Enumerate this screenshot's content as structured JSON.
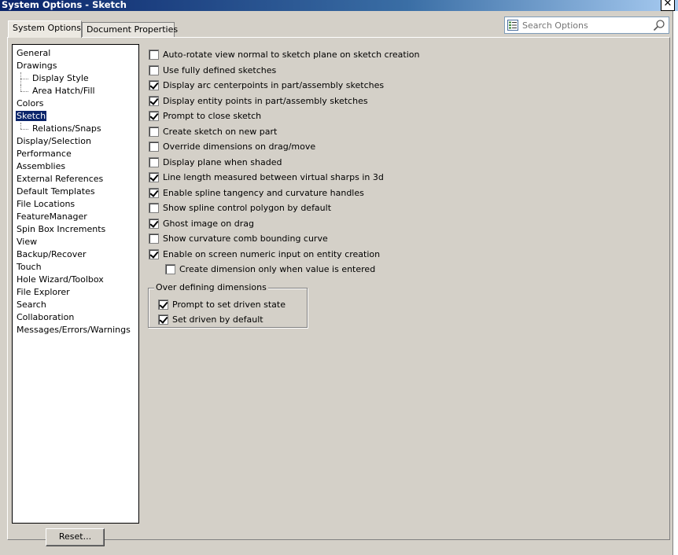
{
  "window": {
    "title": "System Options - Sketch",
    "close_label": "✕"
  },
  "tabs": [
    {
      "label": "System Options",
      "active": true
    },
    {
      "label": "Document Properties",
      "active": false
    }
  ],
  "search": {
    "placeholder": "Search Options",
    "value": ""
  },
  "tree": {
    "items": [
      {
        "label": "General"
      },
      {
        "label": "Drawings"
      },
      {
        "label": "Display Style"
      },
      {
        "label": "Area Hatch/Fill"
      },
      {
        "label": "Colors"
      },
      {
        "label": "Sketch"
      },
      {
        "label": "Relations/Snaps"
      },
      {
        "label": "Display/Selection"
      },
      {
        "label": "Performance"
      },
      {
        "label": "Assemblies"
      },
      {
        "label": "External References"
      },
      {
        "label": "Default Templates"
      },
      {
        "label": "File Locations"
      },
      {
        "label": "FeatureManager"
      },
      {
        "label": "Spin Box Increments"
      },
      {
        "label": "View"
      },
      {
        "label": "Backup/Recover"
      },
      {
        "label": "Touch"
      },
      {
        "label": "Hole Wizard/Toolbox"
      },
      {
        "label": "File Explorer"
      },
      {
        "label": "Search"
      },
      {
        "label": "Collaboration"
      },
      {
        "label": "Messages/Errors/Warnings"
      }
    ]
  },
  "options": [
    {
      "label": "Auto-rotate view normal to sketch plane on sketch creation",
      "checked": false
    },
    {
      "label": "Use fully defined sketches",
      "checked": false
    },
    {
      "label": "Display arc centerpoints in part/assembly sketches",
      "checked": true
    },
    {
      "label": "Display entity points in part/assembly sketches",
      "checked": true
    },
    {
      "label": "Prompt to close sketch",
      "checked": true
    },
    {
      "label": "Create sketch on new part",
      "checked": false
    },
    {
      "label": "Override dimensions on drag/move",
      "checked": false
    },
    {
      "label": "Display plane when shaded",
      "checked": false
    },
    {
      "label": "Line length measured between virtual sharps in 3d",
      "checked": true
    },
    {
      "label": "Enable spline tangency and curvature handles",
      "checked": true
    },
    {
      "label": "Show spline control polygon by default",
      "checked": false
    },
    {
      "label": "Ghost image on drag",
      "checked": true
    },
    {
      "label": "Show curvature comb bounding curve",
      "checked": false
    },
    {
      "label": "Enable on screen numeric input on entity creation",
      "checked": true
    },
    {
      "label": "Create dimension only when value is entered",
      "checked": false
    }
  ],
  "over_defining": {
    "legend": "Over defining dimensions",
    "options": [
      {
        "label": "Prompt to set driven state",
        "checked": true
      },
      {
        "label": "Set driven by default",
        "checked": true
      }
    ]
  },
  "reset_label": "Reset..."
}
